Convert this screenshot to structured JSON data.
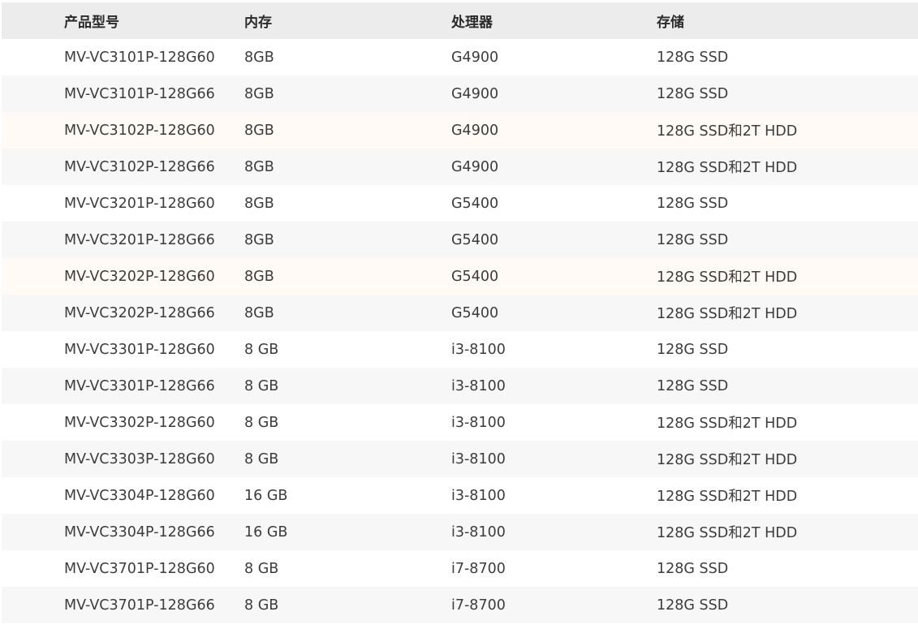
{
  "table": {
    "headers": [
      "产品型号",
      "内存",
      "处理器",
      "存储"
    ],
    "rows": [
      [
        "MV-VC3101P-128G60",
        "8GB",
        "G4900",
        "128G SSD"
      ],
      [
        "MV-VC3101P-128G66",
        "8GB",
        "G4900",
        "128G SSD"
      ],
      [
        "MV-VC3102P-128G60",
        "8GB",
        "G4900",
        "128G SSD和2T HDD"
      ],
      [
        "MV-VC3102P-128G66",
        "8GB",
        "G4900",
        "128G SSD和2T HDD"
      ],
      [
        "MV-VC3201P-128G60",
        "8GB",
        "G5400",
        "128G SSD"
      ],
      [
        "MV-VC3201P-128G66",
        "8GB",
        "G5400",
        "128G SSD"
      ],
      [
        "MV-VC3202P-128G60",
        "8GB",
        "G5400",
        "128G SSD和2T HDD"
      ],
      [
        "MV-VC3202P-128G66",
        "8GB",
        "G5400",
        "128G SSD和2T HDD"
      ],
      [
        "MV-VC3301P-128G60",
        "8 GB",
        "i3-8100",
        "128G SSD"
      ],
      [
        "MV-VC3301P-128G66",
        "8 GB",
        "i3-8100",
        "128G SSD"
      ],
      [
        "MV-VC3302P-128G60",
        "8 GB",
        "i3-8100",
        "128G SSD和2T HDD"
      ],
      [
        "MV-VC3303P-128G60",
        "8 GB",
        "i3-8100",
        "128G SSD和2T HDD"
      ],
      [
        "MV-VC3304P-128G60",
        "16 GB",
        "i3-8100",
        "128G SSD和2T HDD"
      ],
      [
        "MV-VC3304P-128G66",
        "16 GB",
        "i3-8100",
        "128G SSD和2T HDD"
      ],
      [
        "MV-VC3701P-128G60",
        "8 GB",
        "i7-8700",
        "128G SSD"
      ],
      [
        "MV-VC3701P-128G66",
        "8 GB",
        "i7-8700",
        "128G SSD"
      ]
    ]
  },
  "colors": {
    "header_bg": "#ececec",
    "row_stripe": "#f7f7f7",
    "row_warm": "#fffaf6",
    "text": "#3c3c3c"
  }
}
